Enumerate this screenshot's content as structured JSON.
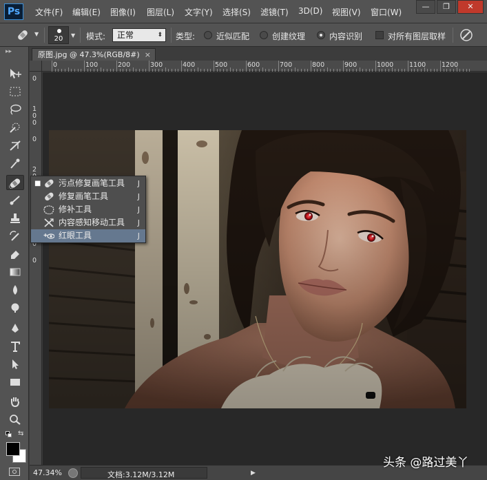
{
  "app": {
    "logo": "Ps",
    "menu": [
      "文件(F)",
      "编辑(E)",
      "图像(I)",
      "图层(L)",
      "文字(Y)",
      "选择(S)",
      "滤镜(T)",
      "3D(D)",
      "视图(V)",
      "窗口(W)"
    ],
    "window_controls": [
      "—",
      "❐",
      "✕"
    ]
  },
  "options_bar": {
    "brush_size": "20",
    "mode_label": "模式:",
    "mode_value": "正常",
    "type_label": "类型:",
    "type_options": [
      "近似匹配",
      "创建纹理",
      "内容识别"
    ],
    "type_selected": 2,
    "sample_all_label": "对所有图层取样",
    "sample_all_checked": false
  },
  "document": {
    "tab_title": "原图.jpg @ 47.3%(RGB/8#)",
    "tab_close": "×",
    "ruler_h": [
      "0",
      "100",
      "200",
      "300",
      "400",
      "500",
      "600",
      "700",
      "800",
      "900",
      "1000",
      "1100",
      "1200"
    ],
    "ruler_v": [
      "0",
      "100",
      "0",
      "200",
      "0",
      "300",
      "0"
    ]
  },
  "toolbar": {
    "active_tool": "spot-healing-brush",
    "tools": [
      "move",
      "marquee",
      "lasso",
      "quick-selection",
      "crop",
      "eyedropper",
      "spot-healing-brush",
      "brush",
      "clone-stamp",
      "history-brush",
      "eraser",
      "gradient",
      "blur",
      "dodge",
      "pen",
      "type",
      "path-selection",
      "shape",
      "hand",
      "zoom"
    ],
    "foreground_color": "#000000",
    "background_color": "#ffffff"
  },
  "flyout": {
    "items": [
      {
        "label": "污点修复画笔工具",
        "key": "J",
        "icon": "spot-healing-icon",
        "selected": true
      },
      {
        "label": "修复画笔工具",
        "key": "J",
        "icon": "healing-brush-icon",
        "selected": false
      },
      {
        "label": "修补工具",
        "key": "J",
        "icon": "patch-icon",
        "selected": false
      },
      {
        "label": "内容感知移动工具",
        "key": "J",
        "icon": "content-aware-move-icon",
        "selected": false
      },
      {
        "label": "红眼工具",
        "key": "J",
        "icon": "red-eye-icon",
        "selected": false,
        "highlighted": true
      }
    ]
  },
  "status": {
    "zoom": "47.34%",
    "doc_size": "文档:3.12M/3.12M"
  },
  "watermark": "头条 @路过美丫",
  "colors": {
    "ui_bg": "#535353",
    "canvas_bg": "#282828",
    "highlight": "#65788f",
    "red_eye": "#e0141e"
  }
}
